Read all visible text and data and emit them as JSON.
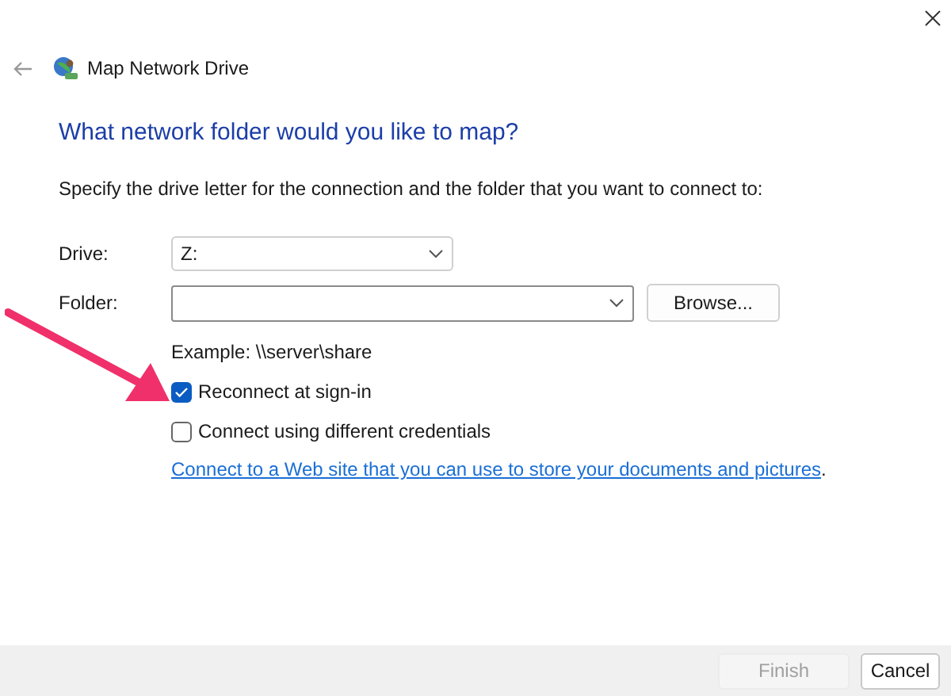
{
  "window": {
    "title": "Map Network Drive"
  },
  "heading": "What network folder would you like to map?",
  "instruction": "Specify the drive letter for the connection and the folder that you want to connect to:",
  "drive": {
    "label": "Drive:",
    "value": "Z:"
  },
  "folder": {
    "label": "Folder:",
    "browse": "Browse..."
  },
  "example": "Example: \\\\server\\share",
  "options": [
    {
      "label": "Reconnect at sign-in",
      "checked": true
    },
    {
      "label": "Connect using different credentials",
      "checked": false
    }
  ],
  "link": {
    "text": "Connect to a Web site that you can use to store your documents and pictures",
    "after": "."
  },
  "buttons": [
    {
      "label": "Finish",
      "disabled": true
    },
    {
      "label": "Cancel",
      "disabled": false
    }
  ]
}
